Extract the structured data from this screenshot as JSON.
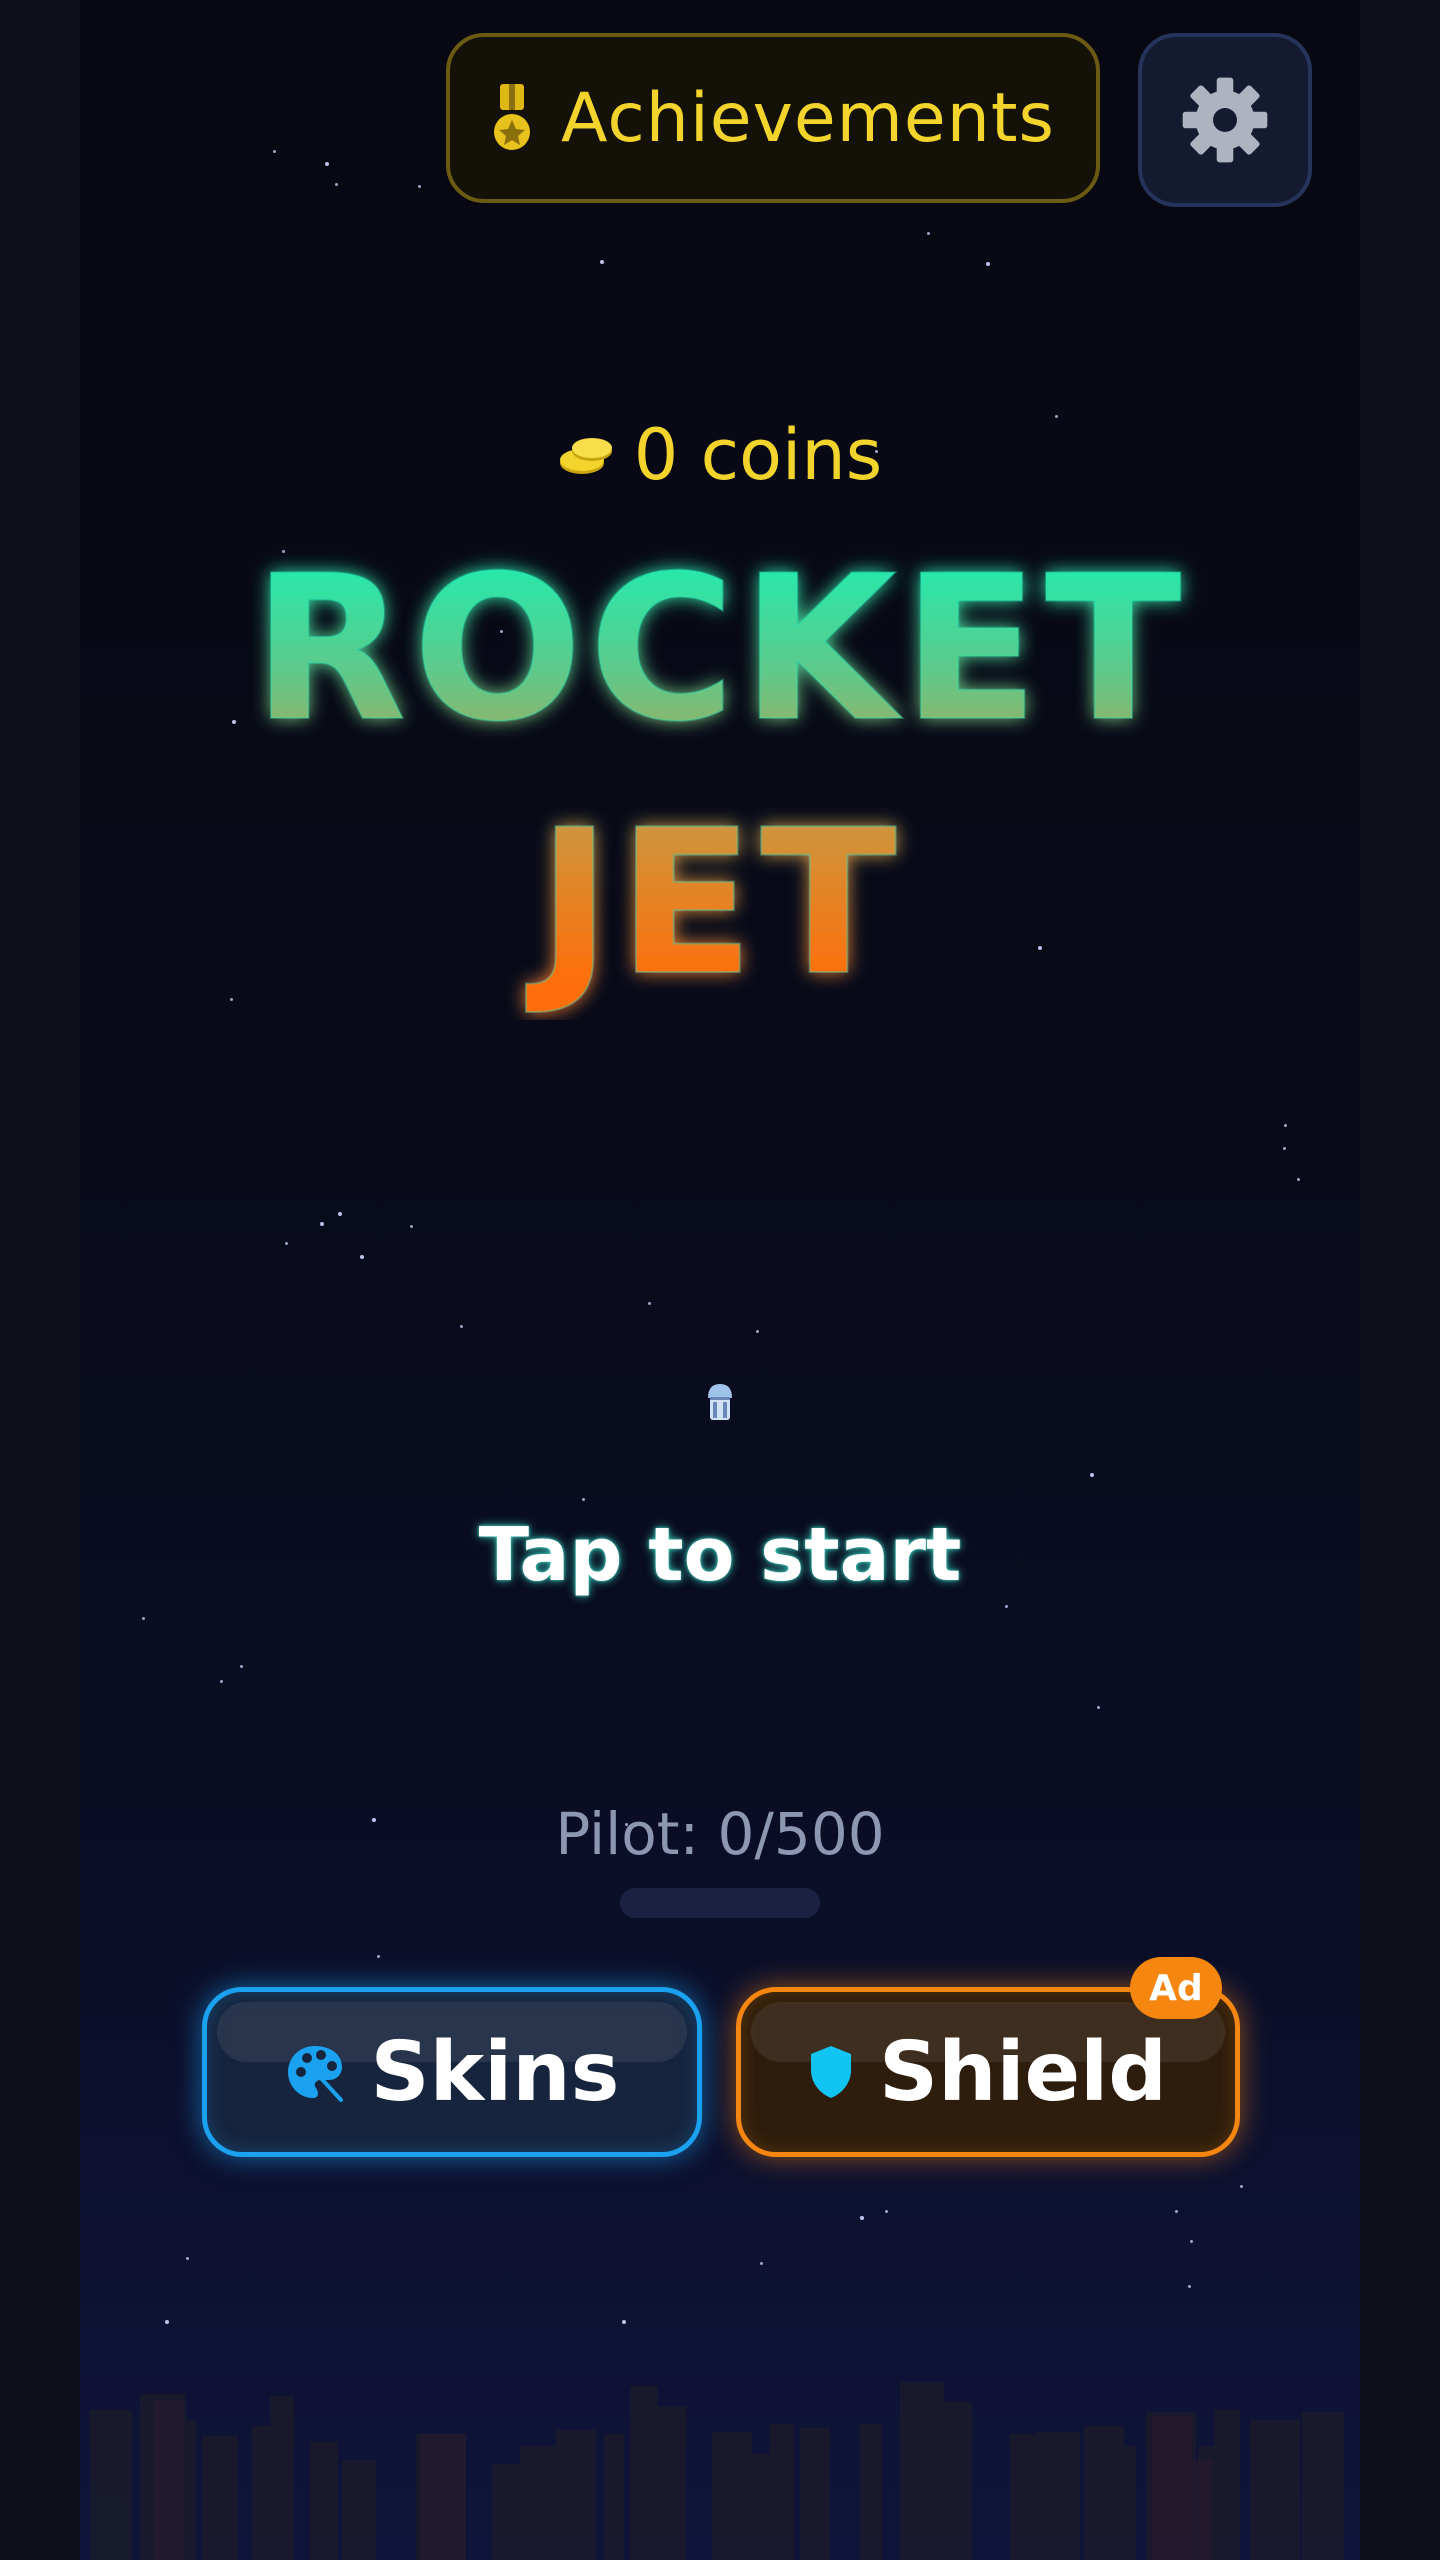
{
  "header": {
    "achievements_label": "Achievements"
  },
  "wallet": {
    "coins_text": "0 coins"
  },
  "title": {
    "line1": "ROCKET",
    "line2": "JET"
  },
  "prompt": {
    "tap_text": "Tap to start"
  },
  "pilot": {
    "label": "Pilot: 0/500",
    "progress": 0
  },
  "actions": {
    "skins_label": "Skins",
    "shield_label": "Shield",
    "ad_badge": "Ad"
  },
  "colors": {
    "gold": "#f3d42c",
    "teal": "#1de9b6",
    "orange": "#ff7a10",
    "skins_blue": "#1aa1f0",
    "shield_orange": "#f5860f"
  },
  "icons": [
    "medal-icon",
    "gear-icon",
    "coins-icon",
    "rocket-icon",
    "palette-icon",
    "shield-icon"
  ]
}
